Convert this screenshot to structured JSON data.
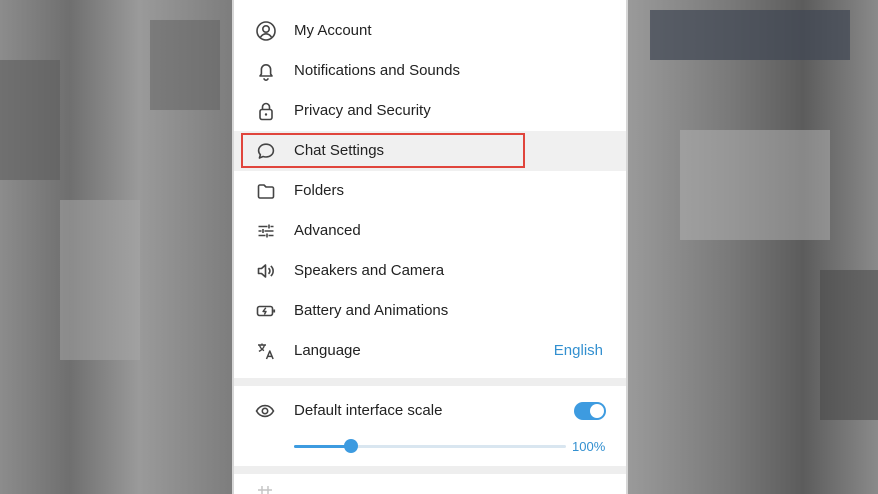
{
  "menu": {
    "items": [
      {
        "id": "my-account",
        "label": "My Account",
        "icon": "account-icon"
      },
      {
        "id": "notifications",
        "label": "Notifications and Sounds",
        "icon": "bell-icon"
      },
      {
        "id": "privacy",
        "label": "Privacy and Security",
        "icon": "lock-icon"
      },
      {
        "id": "chat-settings",
        "label": "Chat Settings",
        "icon": "chat-bubble-icon"
      },
      {
        "id": "folders",
        "label": "Folders",
        "icon": "folder-icon"
      },
      {
        "id": "advanced",
        "label": "Advanced",
        "icon": "sliders-icon"
      },
      {
        "id": "speakers",
        "label": "Speakers and Camera",
        "icon": "speaker-icon"
      },
      {
        "id": "battery",
        "label": "Battery and Animations",
        "icon": "battery-icon"
      },
      {
        "id": "language",
        "label": "Language",
        "icon": "translate-icon",
        "value": "English"
      }
    ],
    "active": "chat-settings"
  },
  "scale": {
    "label": "Default interface scale",
    "icon": "eye-icon",
    "enabled": true,
    "value_label": "100%",
    "slider_level": 0.21
  },
  "colors": {
    "accent": "#3d9be0",
    "link": "#3390d0",
    "highlight_border": "#e0453c",
    "active_row": "#f0f0f0"
  }
}
